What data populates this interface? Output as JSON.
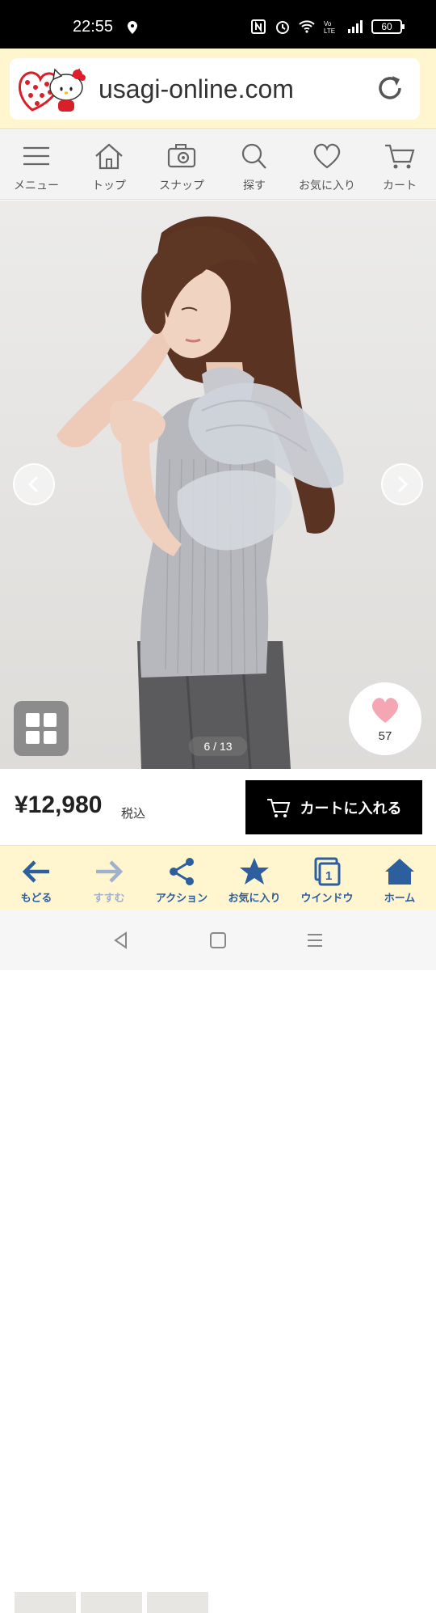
{
  "status_bar": {
    "time": "22:55",
    "battery": "60",
    "icons": [
      "location-icon",
      "nfc-icon",
      "alarm-icon",
      "wifi-icon",
      "volte-icon",
      "signal-icon",
      "battery-icon"
    ]
  },
  "browser": {
    "url": "usagi-online.com",
    "logo_icon": "hello-kitty-logo",
    "reload_icon": "reload-icon"
  },
  "site_nav": {
    "items": [
      {
        "label": "メニュー",
        "icon": "hamburger-icon"
      },
      {
        "label": "トップ",
        "icon": "home-icon"
      },
      {
        "label": "スナップ",
        "icon": "camera-icon"
      },
      {
        "label": "探す",
        "icon": "search-icon"
      },
      {
        "label": "お気に入り",
        "icon": "heart-icon"
      },
      {
        "label": "カート",
        "icon": "cart-icon"
      }
    ]
  },
  "product": {
    "image_counter": "6 / 13",
    "favorite_count": "57",
    "price": "¥12,980",
    "tax_label": "税込",
    "cart_button_label": "カートに入れる"
  },
  "browser_toolbar": {
    "items": [
      {
        "label": "もどる",
        "icon": "arrow-left-icon"
      },
      {
        "label": "すすむ",
        "icon": "arrow-right-icon"
      },
      {
        "label": "アクション",
        "icon": "share-icon"
      },
      {
        "label": "お気に入り",
        "icon": "star-icon"
      },
      {
        "label": "ウインドウ",
        "icon": "window-icon"
      },
      {
        "label": "ホーム",
        "icon": "home-icon"
      }
    ]
  },
  "colors": {
    "url_bar_bg": "#fff6cf",
    "toolbar_accent": "#2d5e9e",
    "heart": "#f4a7b3",
    "cart_button_bg": "#000000"
  }
}
